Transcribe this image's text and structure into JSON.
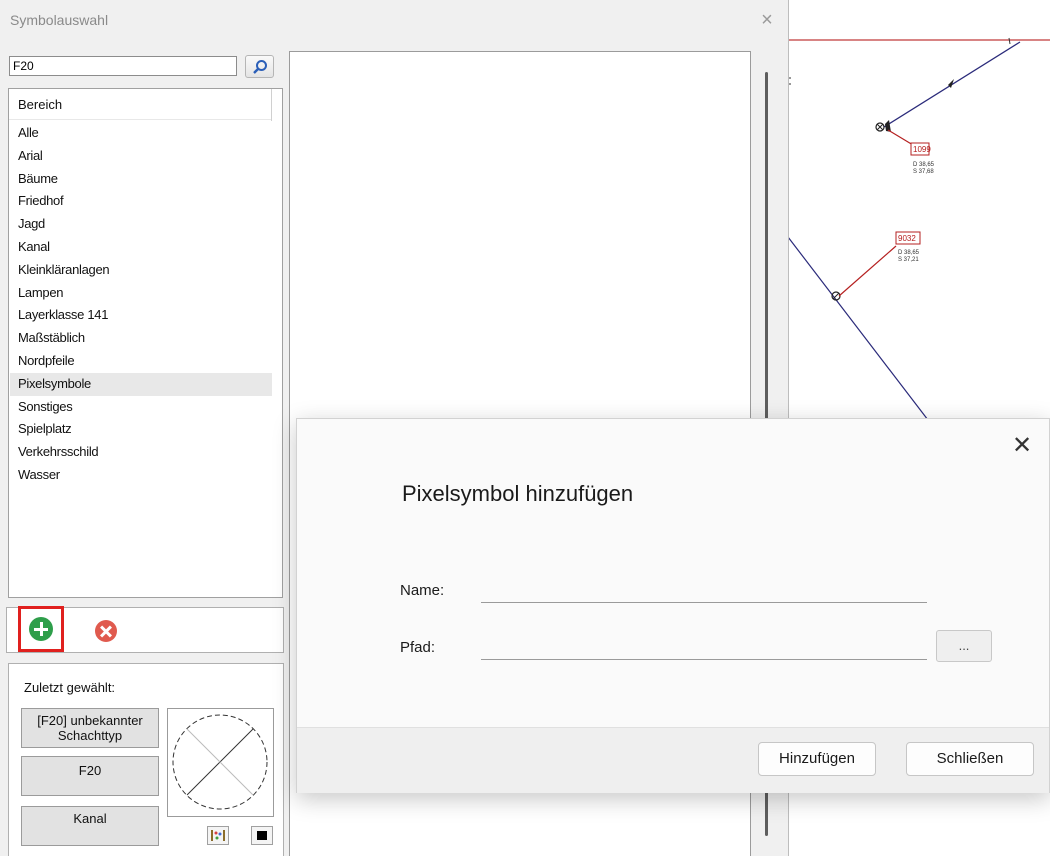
{
  "window": {
    "title": "Symbolauswahl",
    "close_glyph": "×"
  },
  "search": {
    "value": "F20",
    "icon": "search-icon"
  },
  "category_list": {
    "header": "Bereich",
    "items": [
      "Alle",
      "Arial",
      "Bäume",
      "Friedhof",
      "Jagd",
      "Kanal",
      "Kleinkläranlagen",
      "Lampen",
      "Layerklasse 141",
      "Maßstäblich",
      "Nordpfeile",
      "Pixelsymbole",
      "Sonstiges",
      "Spielplatz",
      "Verkehrsschild",
      "Wasser"
    ],
    "selected": "Pixelsymbole"
  },
  "toolbar": {
    "add_icon": "add-circle-icon",
    "remove_icon": "remove-circle-icon",
    "highlight_color": "#e0201e"
  },
  "recent": {
    "label": "Zuletzt gewählt:",
    "buttons": [
      "[F20] unbekannter Schachttyp",
      "F20",
      "Kanal"
    ]
  },
  "map": {
    "labels": [
      "1099",
      "D 38,65",
      "S 37,68",
      "9032",
      "D 38,65",
      "S 37,21"
    ]
  },
  "dialog": {
    "title": "Pixelsymbol hinzufügen",
    "name_label": "Name:",
    "name_value": "",
    "path_label": "Pfad:",
    "path_value": "",
    "browse_label": "...",
    "add_label": "Hinzufügen",
    "close_label": "Schließen",
    "close_glyph": "✕"
  }
}
